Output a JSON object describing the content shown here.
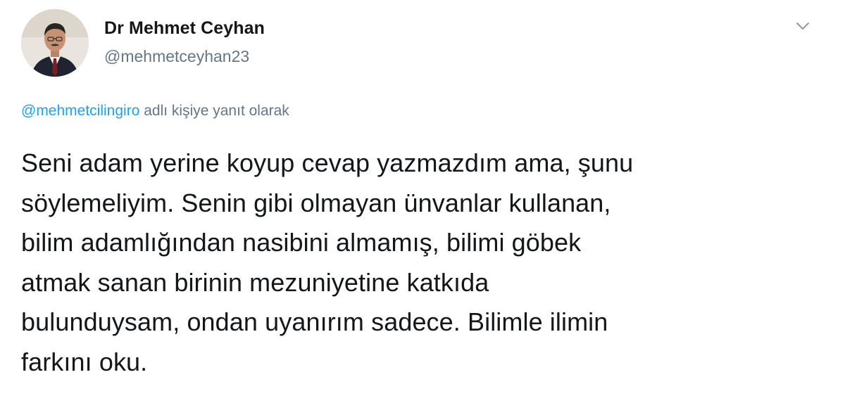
{
  "author": {
    "display_name": "Dr Mehmet Ceyhan",
    "handle": "@mehmetceyhan23"
  },
  "reply_context": {
    "mention": "@mehmetcilingiro",
    "suffix": " adlı kişiye yanıt olarak"
  },
  "tweet": {
    "lines": [
      "Seni adam yerine koyup cevap yazmazdım ama, şunu",
      "söylemeliyim. Senin gibi olmayan ünvanlar kullanan,",
      "bilim adamlığından nasibini almamış, bilimi göbek",
      "atmak sanan birinin mezuniyetine katkıda",
      "bulunduysam, ondan uyanırım sadece. Bilimle ilimin",
      "farkını oku."
    ]
  },
  "icons": {
    "avatar": "profile-photo",
    "menu": "chevron-down-icon"
  },
  "colors": {
    "text": "#14171a",
    "secondary": "#657786",
    "link": "#1da1f2"
  }
}
